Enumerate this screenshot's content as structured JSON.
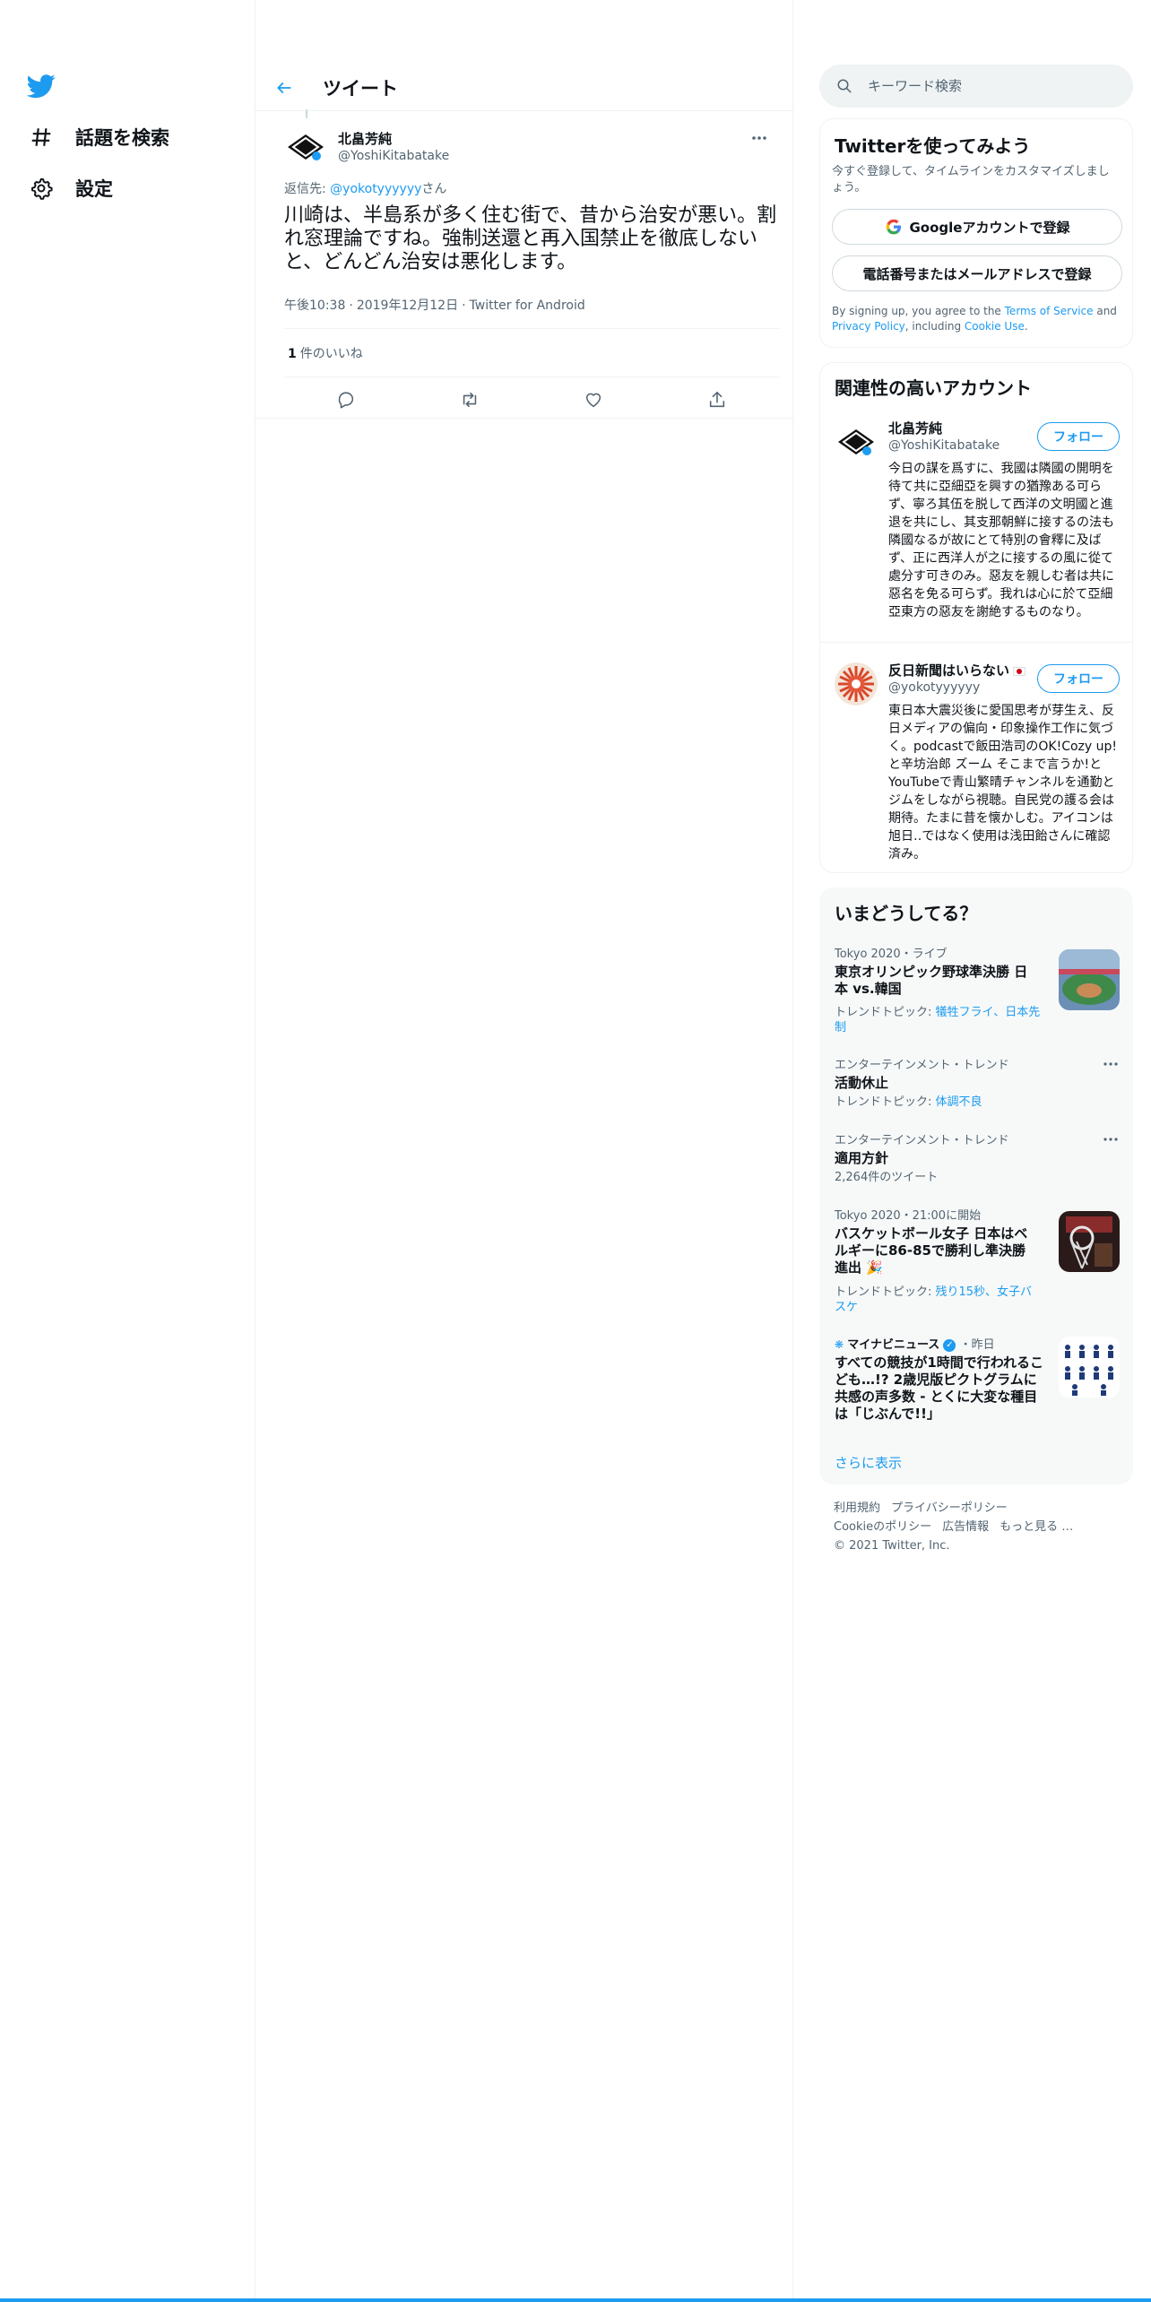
{
  "nav": {
    "explore_label": "話題を検索",
    "settings_label": "設定"
  },
  "header": {
    "title": "ツイート"
  },
  "tweet": {
    "author_name": "北畠芳純",
    "author_handle": "@YoshiKitabatake",
    "reply_prefix": "返信先: ",
    "reply_handle": "@yokotyyyyyy",
    "reply_suffix": "さん",
    "text": "川崎は、半島系が多く住む街で、昔から治安が悪い。割れ窓理論ですね。強制送還と再入国禁止を徹底しないと、どんどん治安は悪化します。",
    "time": "午後10:38",
    "date": "2019年12月12日",
    "source": "Twitter for Android",
    "sep": "·",
    "likes_count": "1",
    "likes_label": "件のいいね"
  },
  "search": {
    "placeholder": "キーワード検索"
  },
  "signup": {
    "title": "Twitterを使ってみよう",
    "subtitle": "今すぐ登録して、タイムラインをカスタマイズしましょう。",
    "google_label": "Googleアカウントで登録",
    "phone_label": "電話番号またはメールアドレスで登録",
    "fine_1": "By signing up, you agree to the ",
    "terms": "Terms of Service",
    "fine_2": " and ",
    "privacy": "Privacy Policy",
    "fine_3": ", including ",
    "cookie": "Cookie Use",
    "fine_4": "."
  },
  "related": {
    "title": "関連性の高いアカウント",
    "accounts": [
      {
        "name": "北畠芳純",
        "handle": "@YoshiKitabatake",
        "follow_label": "フォロー",
        "bio": "今日の謀を爲すに、我國は隣國の開明を待て共に亞細亞を興すの猶豫ある可らず、寧ろ其伍を脱して西洋の文明國と進退を共にし、其支那朝鮮に接するの法も隣國なるが故にとて特別の會釋に及ばず、正に西洋人が之に接するの風に從て處分す可きのみ。惡友を親しむ者は共に惡名を免る可らず。我れは心に於て亞細亞東方の惡友を謝絶するものなり。"
      },
      {
        "name": "反日新聞はいらない",
        "handle": "@yokotyyyyyy",
        "follow_label": "フォロー",
        "bio": "東日本大震災後に愛国思考が芽生え、反日メディアの偏向・印象操作工作に気づく。podcastで飯田浩司のOK!Cozy up! と辛坊治郎 ズーム そこまで言うか!とYouTubeで青山繁晴チャンネルを通勤とジムをしながら視聴。自民党の護る会は期待。たまに昔を懐かしむ。アイコンは旭日‥ではなく使用は浅田飴さんに確認済み。"
      }
    ]
  },
  "trends": {
    "title": "いまどうしてる？",
    "items": [
      {
        "context": "Tokyo 2020・ライブ",
        "title": "東京オリンピック野球準決勝 日本 vs.韓国",
        "topic_prefix": "トレンドトピック: ",
        "topics": "犠牲フライ、日本先制"
      },
      {
        "context": "エンターテインメント・トレンド",
        "title": "活動休止",
        "topic_prefix": "トレンドトピック: ",
        "topics": "体調不良"
      },
      {
        "context": "エンターテインメント・トレンド",
        "title": "適用方針",
        "count": "2,264件のツイート"
      },
      {
        "context": "Tokyo 2020・21:00に開始",
        "title": "バスケットボール女子 日本はベルギーに86-85で勝利し準決勝進出 🎉",
        "topic_prefix": "トレンドトピック: ",
        "topics": "残り15秒、女子バスケ"
      },
      {
        "source": "マイナビニュース",
        "time": "・昨日",
        "title": "すべての競技が1時間で行われるこども…!? 2歳児版ピクトグラムに共感の声多数 - とくに大変な種目は「じぶんで!!」"
      }
    ],
    "show_more": "さらに表示"
  },
  "footer": {
    "terms": "利用規約",
    "privacy": "プライバシーポリシー",
    "cookie": "Cookieのポリシー",
    "ads": "広告情報",
    "more": "もっと見る …",
    "copyright": "© 2021 Twitter, Inc."
  },
  "colors": {
    "accent": "#1d9bf0",
    "text": "#0f1419",
    "secondary": "#536471",
    "border": "#eff3f4"
  }
}
